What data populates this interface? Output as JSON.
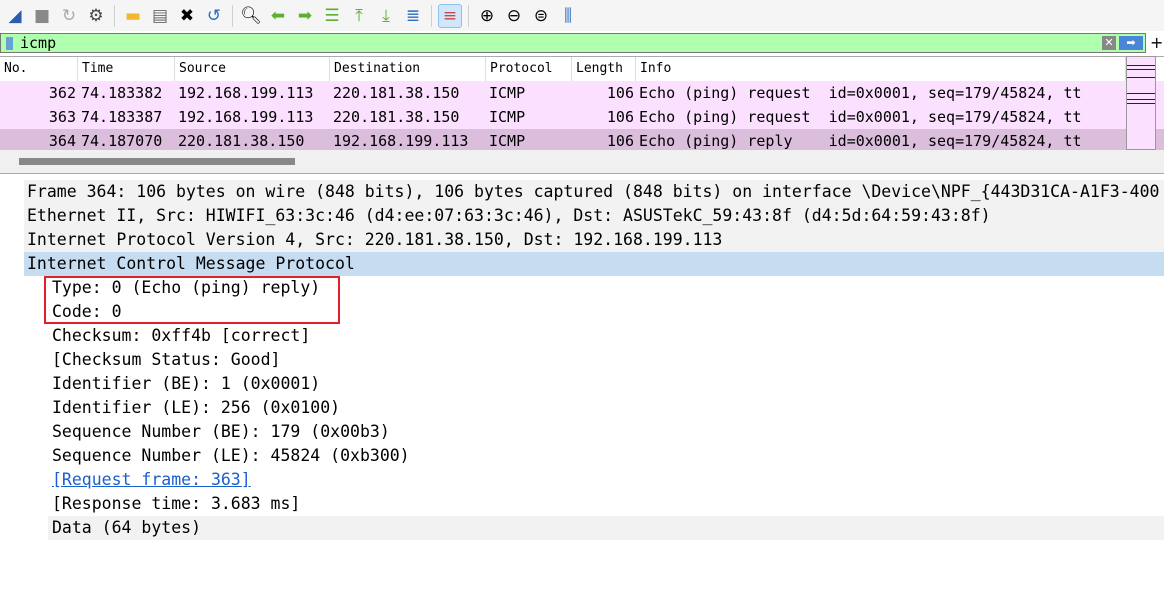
{
  "toolbar": {
    "icons": [
      "shark-fin-start-icon",
      "stop-icon",
      "restart-icon",
      "options-gear-icon",
      "open-folder-icon",
      "save-file-icon",
      "close-file-icon",
      "reload-icon",
      "find-icon",
      "back-arrow-icon",
      "forward-arrow-icon",
      "go-to-packet-icon",
      "first-packet-icon",
      "last-packet-icon",
      "autoscroll-icon",
      "colorize-icon",
      "zoom-in-icon",
      "zoom-out-icon",
      "normal-size-icon",
      "resize-columns-icon"
    ]
  },
  "filter": {
    "value": "icmp",
    "accent": "#afffaf"
  },
  "packet_list": {
    "columns": [
      "No.",
      "Time",
      "Source",
      "Destination",
      "Protocol",
      "Length",
      "Info"
    ],
    "rows": [
      {
        "no": "362",
        "time": "74.183382",
        "src": "192.168.199.113",
        "dst": "220.181.38.150",
        "proto": "ICMP",
        "len": "106",
        "info": "Echo (ping) request  id=0x0001, seq=179/45824, tt"
      },
      {
        "no": "363",
        "time": "74.183387",
        "src": "192.168.199.113",
        "dst": "220.181.38.150",
        "proto": "ICMP",
        "len": "106",
        "info": "Echo (ping) request  id=0x0001, seq=179/45824, tt"
      },
      {
        "no": "364",
        "time": "74.187070",
        "src": "220.181.38.150",
        "dst": "192.168.199.113",
        "proto": "ICMP",
        "len": "106",
        "info": "Echo (ping) reply    id=0x0001, seq=179/45824, tt"
      }
    ]
  },
  "details": {
    "frame": "Frame 364: 106 bytes on wire (848 bits), 106 bytes captured (848 bits) on interface \\Device\\NPF_{443D31CA-A1F3-400",
    "ethernet": "Ethernet II, Src: HIWIFI_63:3c:46 (d4:ee:07:63:3c:46), Dst: ASUSTekC_59:43:8f (d4:5d:64:59:43:8f)",
    "ip": "Internet Protocol Version 4, Src: 220.181.38.150, Dst: 192.168.199.113",
    "icmp": "Internet Control Message Protocol",
    "icmp_fields": [
      "Type: 0 (Echo (ping) reply)",
      "Code: 0",
      "Checksum: 0xff4b [correct]",
      "[Checksum Status: Good]",
      "Identifier (BE): 1 (0x0001)",
      "Identifier (LE): 256 (0x0100)",
      "Sequence Number (BE): 179 (0x00b3)",
      "Sequence Number (LE): 45824 (0xb300)"
    ],
    "request_frame": "[Request frame: 363]",
    "response_time": "[Response time: 3.683 ms]",
    "data": "Data (64 bytes)"
  },
  "colors": {
    "icmp_row": "#fce0ff",
    "selected_row": "#dabedc",
    "expanded": "#c5dcf1",
    "highlight_box": "#e0202a"
  }
}
